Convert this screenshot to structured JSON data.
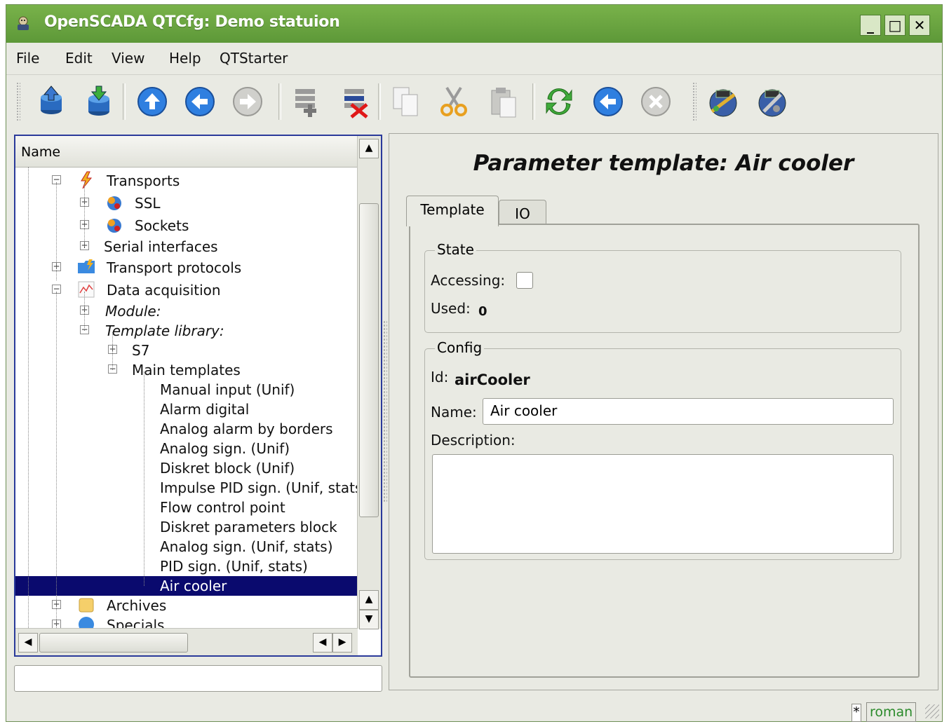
{
  "window": {
    "title": "OpenSCADA QTCfg: Demo statuion"
  },
  "menu": {
    "file": "File",
    "edit": "Edit",
    "view": "View",
    "help": "Help",
    "qtstarter": "QTStarter"
  },
  "tree": {
    "header": "Name",
    "items": {
      "transports": "Transports",
      "ssl": "SSL",
      "sockets": "Sockets",
      "serial": "Serial interfaces",
      "transport_protocols": "Transport protocols",
      "data_acquisition": "Data acquisition",
      "module": "Module:",
      "template_library": "Template library:",
      "s7": "S7",
      "main_templates": "Main templates",
      "t1": "Manual input (Unif)",
      "t2": "Alarm digital",
      "t3": "Analog alarm by borders",
      "t4": "Analog sign. (Unif)",
      "t5": "Diskret block (Unif)",
      "t6": "Impulse PID sign. (Unif, stats)",
      "t7": "Flow control point",
      "t8": "Diskret parameters block",
      "t9": "Analog sign. (Unif, stats)",
      "t10": "PID sign. (Unif, stats)",
      "t11": "Air cooler",
      "archives": "Archives",
      "specials": "Specials"
    }
  },
  "page": {
    "title": "Parameter template: Air cooler",
    "tabs": {
      "template": "Template",
      "io": "IO"
    },
    "state": {
      "group": "State",
      "accessing_label": "Accessing:",
      "used_label": "Used:",
      "used_value": "0"
    },
    "config": {
      "group": "Config",
      "id_label": "Id:",
      "id_value": "airCooler",
      "name_label": "Name:",
      "name_value": "Air cooler",
      "description_label": "Description:"
    }
  },
  "status": {
    "modified": "*",
    "user": "roman"
  },
  "colors": {
    "titlebar": "#6aa640",
    "selection": "#0a0a6e",
    "focus_border": "#2a3a9a"
  }
}
